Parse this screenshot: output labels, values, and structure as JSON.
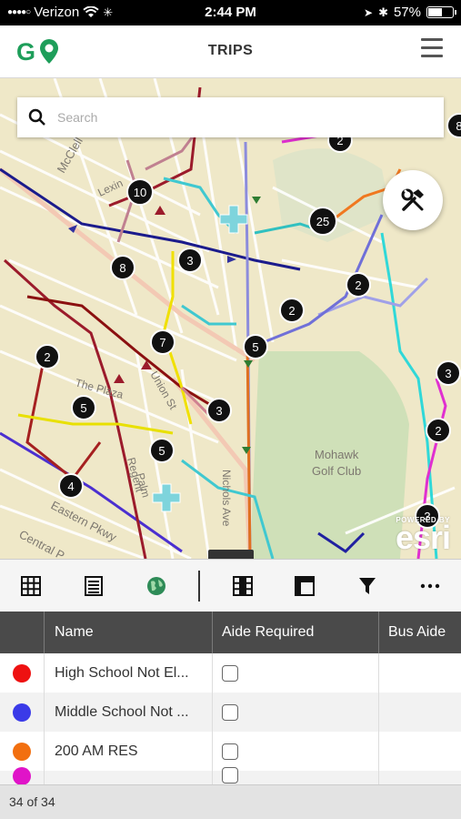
{
  "status_bar": {
    "carrier": "Verizon",
    "time": "2:44 PM",
    "battery": "57%",
    "battery_level": 0.57
  },
  "header": {
    "logo_text": "GO",
    "title": "TRIPS",
    "menu_icon": "hamburger-icon"
  },
  "search": {
    "placeholder": "Search",
    "value": ""
  },
  "map": {
    "tools_icon": "tools-icon",
    "labels": [
      "Mohawk",
      "Golf Club",
      "Eastern Pkwy",
      "Central P",
      "McClell",
      "Lexin",
      "The Plaza",
      "Regent",
      "Palm",
      "Union St",
      "Nichols Ave"
    ],
    "clusters": [
      "10",
      "25",
      "8",
      "3",
      "2",
      "2",
      "2",
      "7",
      "5",
      "2",
      "5",
      "3",
      "5",
      "4",
      "4",
      "3",
      "2",
      "3",
      "8"
    ],
    "attribution_small": "POWERED BY",
    "attribution_brand": "esri"
  },
  "toolbar": {
    "icons": [
      "table-icon",
      "list-icon",
      "globe-icon",
      "columns-icon",
      "layout-icon",
      "filter-icon",
      "more-icon"
    ]
  },
  "grid": {
    "columns": [
      "Name",
      "Aide Required",
      "Bus Aide"
    ],
    "rows": [
      {
        "name": "High School Not El...",
        "color": "#ee1111",
        "aide_required": false
      },
      {
        "name": "Middle School Not ...",
        "color": "#3a3ae8",
        "aide_required": false
      },
      {
        "name": "200 AM RES",
        "color": "#f26f0f",
        "aide_required": false
      },
      {
        "name": "",
        "color": "#e014c8",
        "aide_required": false
      }
    ]
  },
  "footer": {
    "count": "34 of 34"
  },
  "colors": {
    "brand": "#1e9e5a",
    "header_bg": "#4a4a4a",
    "map_bg": "#efe8c8"
  }
}
